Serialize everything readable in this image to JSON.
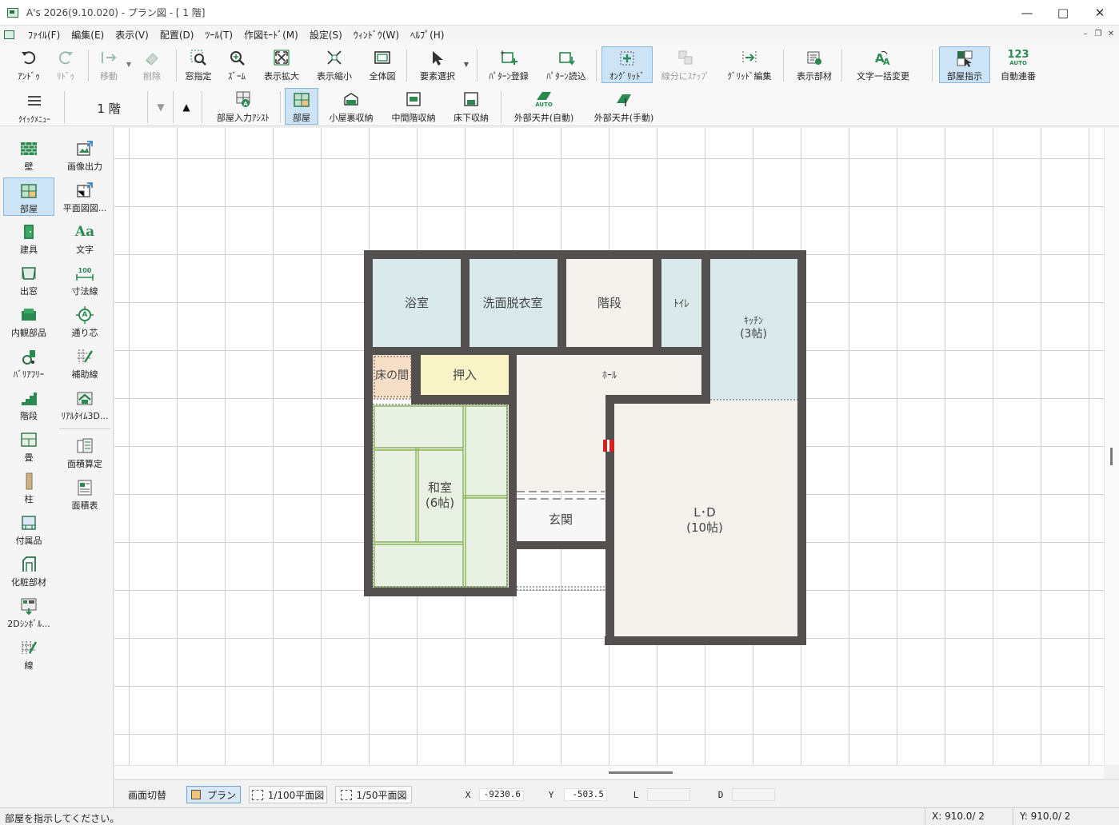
{
  "window": {
    "title": "A's 2026(9.10.020) - プラン図 - [ 1 階]"
  },
  "menu": [
    "ﾌｧｲﾙ(F)",
    "編集(E)",
    "表示(V)",
    "配置(D)",
    "ﾂｰﾙ(T)",
    "作図ﾓｰﾄﾞ(M)",
    "設定(S)",
    "ｳｨﾝﾄﾞｳ(W)",
    "ﾍﾙﾌﾟ(H)"
  ],
  "toolbar1": [
    {
      "label": "ｱﾝﾄﾞｩ",
      "icon": "undo-icon"
    },
    {
      "label": "ﾘﾄﾞｩ",
      "icon": "redo-icon"
    },
    {
      "label": "移動",
      "icon": "move-icon"
    },
    {
      "label": "削除",
      "icon": "eraser-icon"
    },
    {
      "label": "窓指定",
      "icon": "window-zoom-icon"
    },
    {
      "label": "ｽﾞｰﾑ",
      "icon": "zoom-icon"
    },
    {
      "label": "表示拡大",
      "icon": "zoom-in-icon"
    },
    {
      "label": "表示縮小",
      "icon": "zoom-out-icon"
    },
    {
      "label": "全体図",
      "icon": "full-view-icon"
    },
    {
      "label": "要素選択",
      "icon": "cursor-icon"
    },
    {
      "label": "ﾊﾟﾀｰﾝ登録",
      "icon": "pattern-register-icon"
    },
    {
      "label": "ﾊﾟﾀｰﾝ読込",
      "icon": "pattern-load-icon"
    },
    {
      "label": "ｵﾝｸﾞﾘｯﾄﾞ",
      "icon": "on-grid-icon"
    },
    {
      "label": "線分にｽﾅｯﾌﾟ",
      "icon": "snap-line-icon"
    },
    {
      "label": "ｸﾞﾘｯﾄﾞ編集",
      "icon": "grid-edit-icon"
    },
    {
      "label": "表示部材",
      "icon": "display-parts-icon"
    },
    {
      "label": "文字一括変更",
      "icon": "text-replace-icon"
    },
    {
      "label": "部屋指示",
      "icon": "room-point-icon"
    },
    {
      "label": "自動連番",
      "icon": "auto-number-icon"
    }
  ],
  "toolbar2": {
    "quick_menu": "ｸｲｯｸﾒﾆｭｰ",
    "floor": "1 階",
    "buttons": [
      {
        "label": "部屋入力ｱｼｽﾄ",
        "icon": "room-assist-icon"
      },
      {
        "label": "部屋",
        "icon": "room-icon"
      },
      {
        "label": "小屋裏収納",
        "icon": "attic-storage-icon"
      },
      {
        "label": "中間階収納",
        "icon": "mid-floor-storage-icon"
      },
      {
        "label": "床下収納",
        "icon": "underfloor-storage-icon"
      },
      {
        "label": "外部天井(自動)",
        "icon": "outer-ceiling-auto-icon"
      },
      {
        "label": "外部天井(手動)",
        "icon": "outer-ceiling-manual-icon"
      }
    ],
    "auto_badge": "AUTO"
  },
  "left_panel": {
    "col1": [
      "壁",
      "部屋",
      "建具",
      "出窓",
      "内観部品",
      "ﾊﾞﾘｱﾌﾘｰ",
      "階段",
      "畳",
      "柱",
      "付属品",
      "化粧部材",
      "2Dｼﾝﾎﾞﾙ...",
      "線"
    ],
    "col2": [
      "画像出力",
      "平面図図...",
      "文字",
      "寸法線",
      "通り芯",
      "補助線",
      "ﾘｱﾙﾀｲﾑ3D...",
      "面積算定",
      "面積表"
    ]
  },
  "icon_text": {
    "text_icon": "Aa",
    "dimension_icon": "100",
    "axis_icon": "A",
    "auto_number": "123"
  },
  "rooms": {
    "bath": "浴室",
    "dressing": "洗面脱衣室",
    "stairs": "階段",
    "toilet": "ﾄｲﾚ",
    "kitchen": "ｷｯﾁﾝ",
    "kitchen_size": "(3帖)",
    "tokonoma": "床の間",
    "closet": "押入",
    "hall": "ﾎｰﾙ",
    "washitsu": "和室",
    "washitsu_size": "(6帖)",
    "entrance": "玄関",
    "ld": "L･D",
    "ld_size": "(10帖)"
  },
  "view_bar": {
    "switch": "画面切替",
    "plan": "プラン",
    "plan100": "1/100平面図",
    "plan50": "1/50平面図",
    "x_label": "X",
    "x_value": "-9230.6",
    "y_label": "Y",
    "y_value": "-503.5",
    "l_label": "L",
    "l_value": "",
    "d_label": "D",
    "d_value": ""
  },
  "status": {
    "message": "部屋を指示してください。",
    "x_grid": "X: 910.0/ 2",
    "y_grid": "Y: 910.0/ 2"
  },
  "colors": {
    "wall": "#545050",
    "wet_room": "#d9e9ec",
    "floor": "#f5f2ee",
    "tatami": "#e8f1e4",
    "closet": "#f8f4c8",
    "tokonoma": "#f7dfc7",
    "accent": "#cde4f7"
  }
}
